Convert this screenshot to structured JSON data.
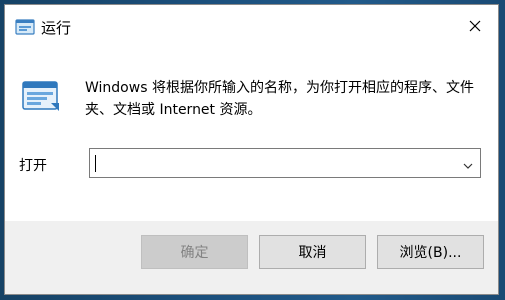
{
  "window": {
    "title": "运行",
    "description": "Windows 将根据你所输入的名称，为你打开相应的程序、文件夹、文档或 Internet 资源。"
  },
  "open": {
    "label": "打开",
    "value": ""
  },
  "buttons": {
    "ok": "确定",
    "cancel": "取消",
    "browse": "浏览(B)..."
  },
  "icons": {
    "title": "run-app-icon",
    "main": "run-app-icon",
    "close": "close-icon",
    "dropdown": "chevron-down-icon"
  },
  "colors": {
    "window_bg": "#f0f0f0",
    "content_bg": "#ffffff",
    "button_bg": "#e1e1e1",
    "disabled_bg": "#cccccc"
  }
}
